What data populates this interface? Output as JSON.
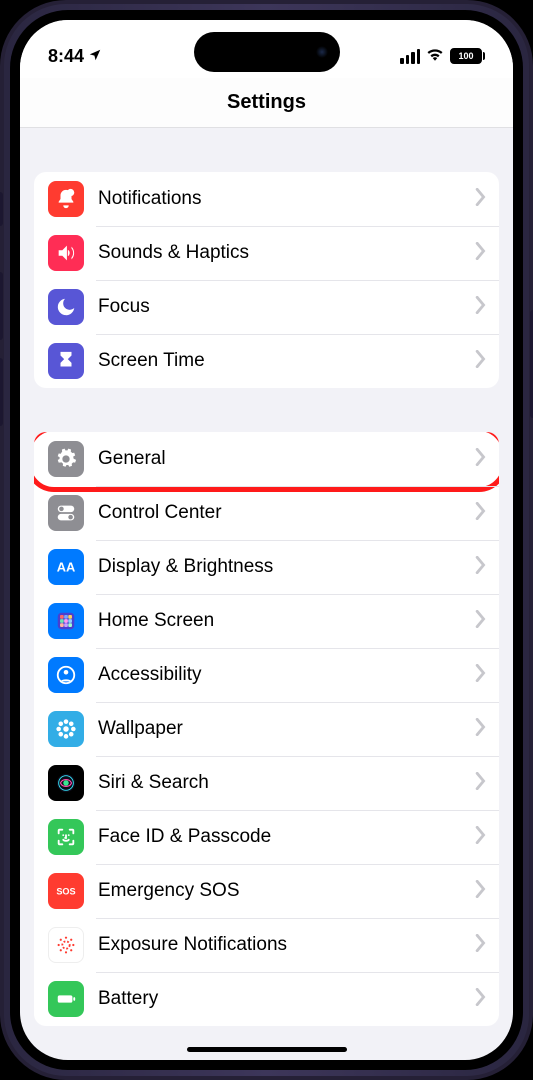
{
  "status": {
    "time": "8:44",
    "battery": "100"
  },
  "header": {
    "title": "Settings"
  },
  "groups": [
    {
      "rows": [
        {
          "id": "notifications",
          "label": "Notifications",
          "icon": "bell",
          "bg": "bg-red"
        },
        {
          "id": "sounds",
          "label": "Sounds & Haptics",
          "icon": "speaker",
          "bg": "bg-pink"
        },
        {
          "id": "focus",
          "label": "Focus",
          "icon": "moon",
          "bg": "bg-indigo"
        },
        {
          "id": "screentime",
          "label": "Screen Time",
          "icon": "hourglass",
          "bg": "bg-indigo"
        }
      ]
    },
    {
      "rows": [
        {
          "id": "general",
          "label": "General",
          "icon": "gear",
          "bg": "bg-gray",
          "highlight": true
        },
        {
          "id": "controlcenter",
          "label": "Control Center",
          "icon": "switches",
          "bg": "bg-gray"
        },
        {
          "id": "display",
          "label": "Display & Brightness",
          "icon": "aa",
          "bg": "bg-blue"
        },
        {
          "id": "homescreen",
          "label": "Home Screen",
          "icon": "grid",
          "bg": "bg-blue"
        },
        {
          "id": "accessibility",
          "label": "Accessibility",
          "icon": "person-circle",
          "bg": "bg-blue"
        },
        {
          "id": "wallpaper",
          "label": "Wallpaper",
          "icon": "flower",
          "bg": "bg-cyan"
        },
        {
          "id": "siri",
          "label": "Siri & Search",
          "icon": "siri",
          "bg": "bg-black"
        },
        {
          "id": "faceid",
          "label": "Face ID & Passcode",
          "icon": "face",
          "bg": "bg-green"
        },
        {
          "id": "sos",
          "label": "Emergency SOS",
          "icon": "sos",
          "bg": "bg-red"
        },
        {
          "id": "exposure",
          "label": "Exposure Notifications",
          "icon": "virus",
          "bg": "bg-white-dots"
        },
        {
          "id": "battery",
          "label": "Battery",
          "icon": "battery",
          "bg": "bg-green"
        }
      ]
    }
  ]
}
